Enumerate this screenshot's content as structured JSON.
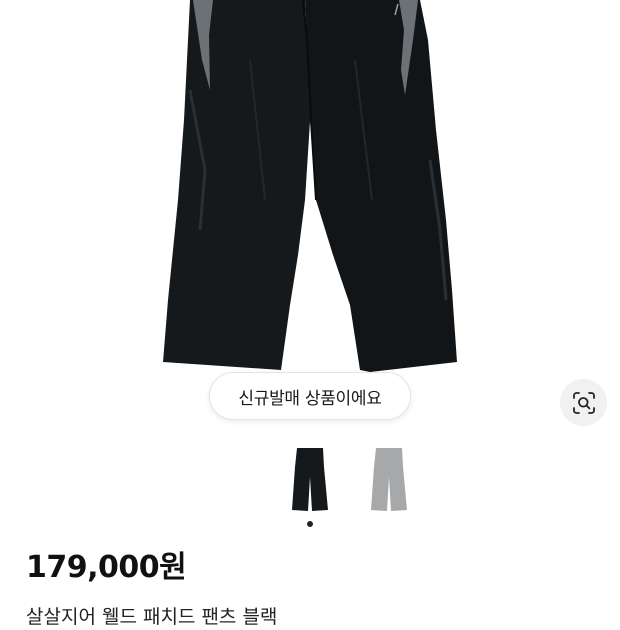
{
  "product": {
    "new_badge": "신규발매 상품이에요",
    "price": "179,000원",
    "title": "살살지어 웰드 패치드 팬츠 블랙"
  },
  "gallery": {
    "active_index": 0,
    "thumbnails": [
      {
        "name": "black",
        "color": "#16191b"
      },
      {
        "name": "grey",
        "color": "#a7a8aa"
      }
    ]
  },
  "icons": {
    "lens": "image-search-icon"
  },
  "colors": {
    "pants_black": "#16191b",
    "pants_grey": "#a7a8aa",
    "badge_border": "#e4e4e4",
    "lens_bg": "#f1f1f1"
  }
}
